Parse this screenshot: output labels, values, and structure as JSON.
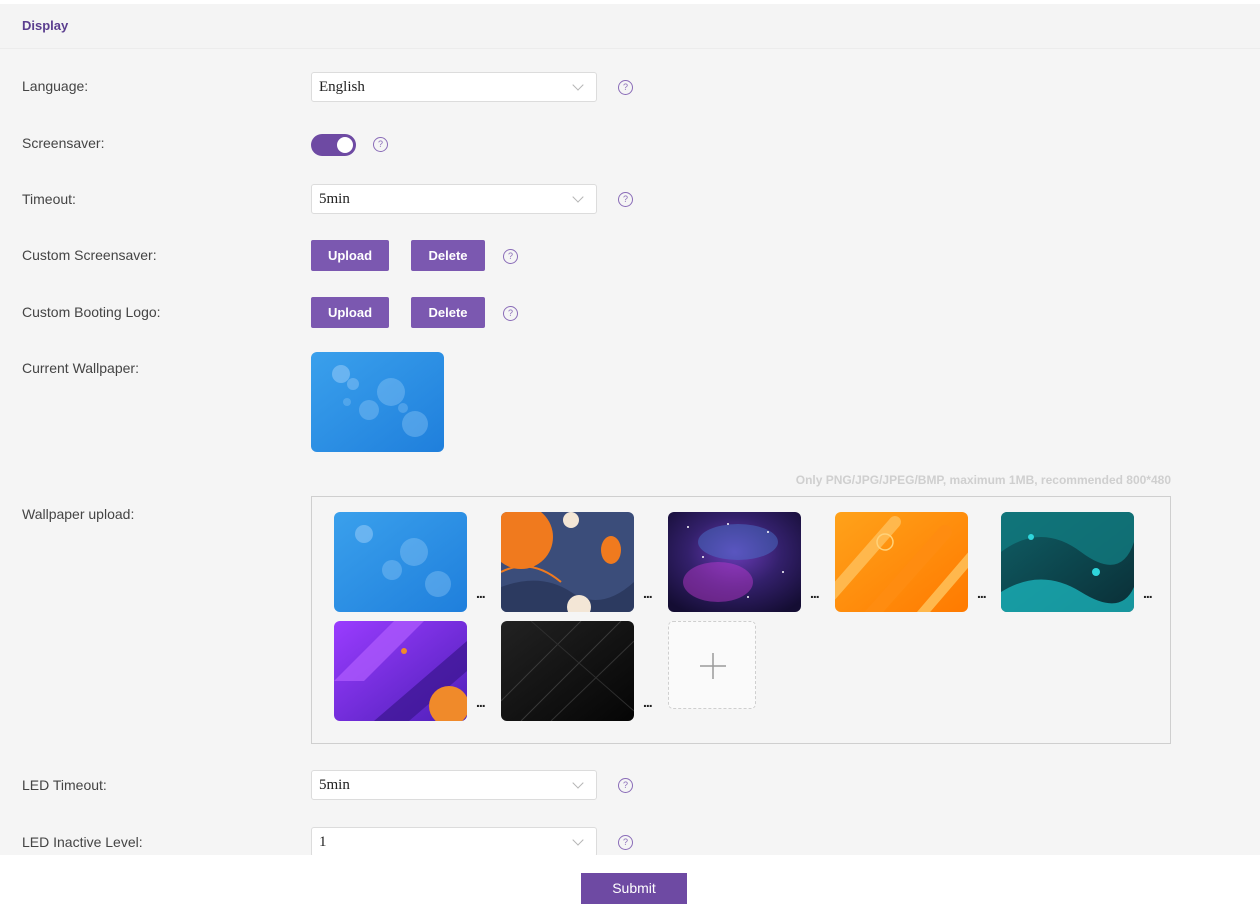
{
  "section": {
    "title": "Display"
  },
  "fields": {
    "language": {
      "label": "Language:",
      "value": "English"
    },
    "screensaver": {
      "label": "Screensaver:",
      "enabled": true
    },
    "timeout": {
      "label": "Timeout:",
      "value": "5min"
    },
    "custom_screensaver": {
      "label": "Custom Screensaver:",
      "upload": "Upload",
      "delete": "Delete"
    },
    "custom_booting_logo": {
      "label": "Custom Booting Logo:",
      "upload": "Upload",
      "delete": "Delete"
    },
    "current_wallpaper": {
      "label": "Current Wallpaper:"
    },
    "wallpaper_upload": {
      "label": "Wallpaper upload:",
      "note": "Only PNG/JPG/JPEG/BMP, maximum 1MB, recommended 800*480",
      "thumbnails": [
        "blue-bubbles",
        "navy-orange-shapes",
        "purple-galaxy",
        "orange-stripes",
        "teal-waves",
        "purple-geometric",
        "black-lines"
      ],
      "more_label": "...",
      "add_icon": "plus-icon"
    },
    "led_timeout": {
      "label": "LED Timeout:",
      "value": "5min"
    },
    "led_inactive_level": {
      "label": "LED Inactive Level:",
      "value": "1"
    }
  },
  "help_icon": "?",
  "submit_label": "Submit",
  "colors": {
    "accent": "#6e4aa3",
    "button": "#7b58b0",
    "background": "#f5f5f5"
  }
}
